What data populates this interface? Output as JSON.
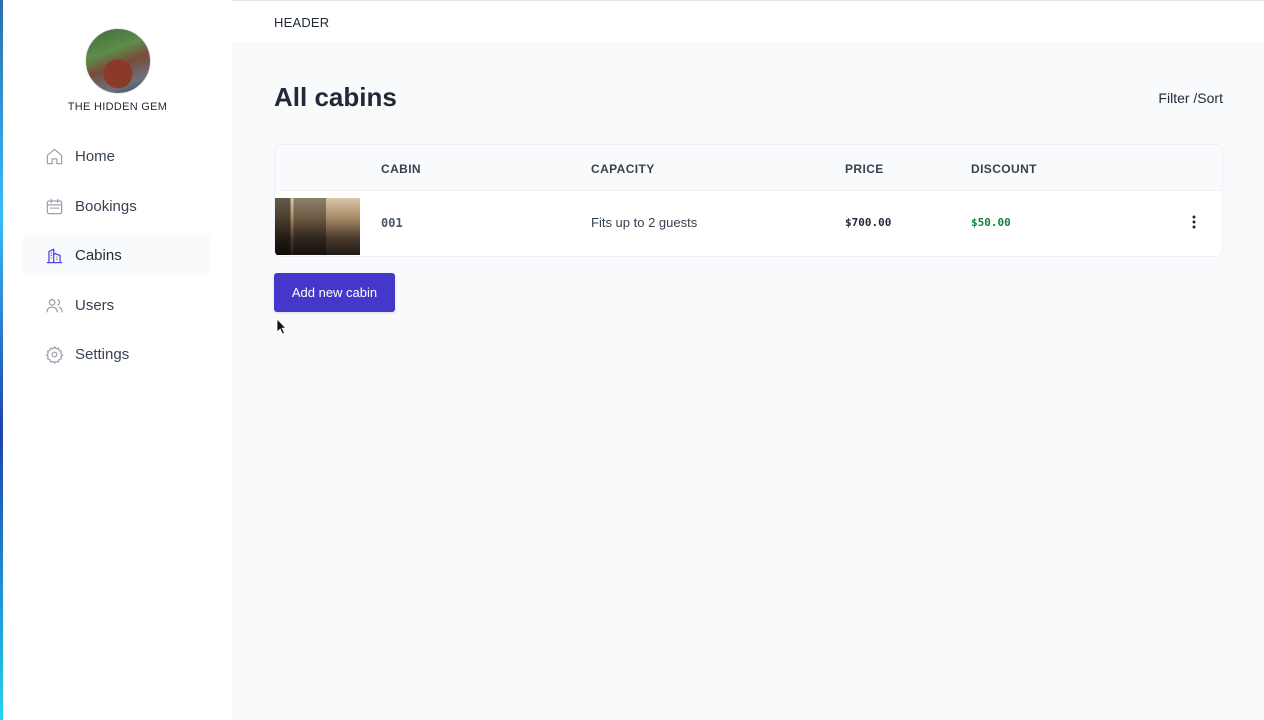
{
  "brand": {
    "name": "THE HIDDEN GEM",
    "logo_icon": "cabin-logo-image"
  },
  "sidebar": {
    "items": [
      {
        "label": "Home",
        "icon": "home-icon",
        "active": false
      },
      {
        "label": "Bookings",
        "icon": "calendar-icon",
        "active": false
      },
      {
        "label": "Cabins",
        "icon": "building-icon",
        "active": true
      },
      {
        "label": "Users",
        "icon": "users-icon",
        "active": false
      },
      {
        "label": "Settings",
        "icon": "gear-icon",
        "active": false
      }
    ]
  },
  "header": {
    "title": "HEADER"
  },
  "main": {
    "title": "All cabins",
    "filter_sort": "Filter /Sort",
    "table": {
      "columns": [
        "CABIN",
        "CAPACITY",
        "PRICE",
        "DISCOUNT"
      ],
      "rows": [
        {
          "cabin": "001",
          "capacity": "Fits up to 2 guests",
          "price": "$700.00",
          "discount": "$50.00"
        }
      ]
    },
    "add_button": "Add new cabin"
  },
  "colors": {
    "accent": "#4338ca",
    "active_icon": "#4f46e5",
    "discount": "#15803d",
    "background": "#f9fafb"
  }
}
